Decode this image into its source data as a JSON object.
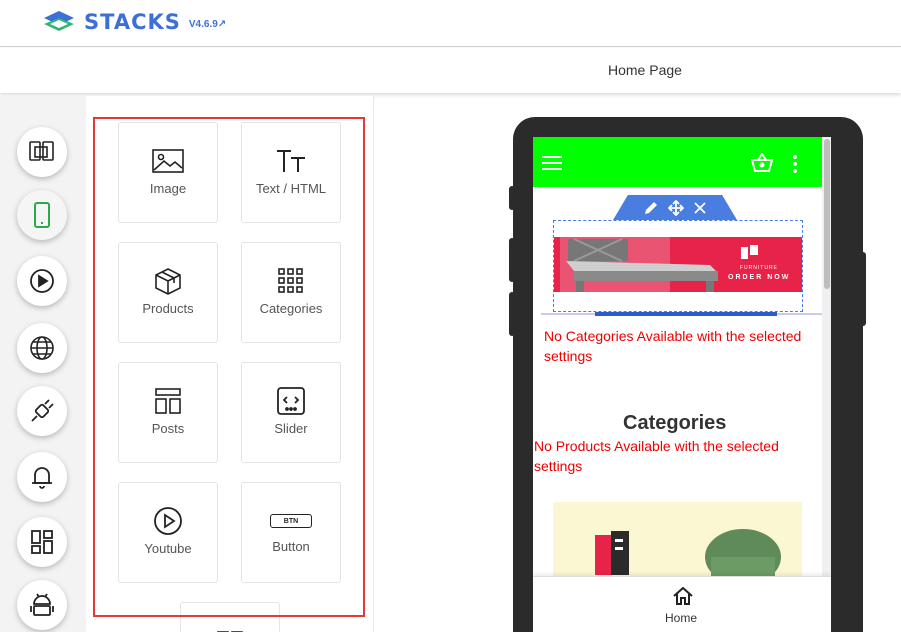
{
  "header": {
    "logo_text": "STACKS",
    "version": "V4.6.9",
    "page_title": "Home Page"
  },
  "rail": [
    {
      "icon": "devices-icon"
    },
    {
      "icon": "mobile-icon",
      "active": true
    },
    {
      "icon": "play-circle-icon"
    },
    {
      "icon": "globe-icon"
    },
    {
      "icon": "plug-icon"
    },
    {
      "icon": "bell-icon"
    },
    {
      "icon": "layout-icon"
    },
    {
      "icon": "android-icon"
    }
  ],
  "widgets": [
    {
      "label": "Image",
      "icon": "image-icon"
    },
    {
      "label": "Text / HTML",
      "icon": "text-icon"
    },
    {
      "label": "Products",
      "icon": "box-icon"
    },
    {
      "label": "Categories",
      "icon": "grid-icon"
    },
    {
      "label": "Posts",
      "icon": "posts-icon"
    },
    {
      "label": "Slider",
      "icon": "slider-icon"
    },
    {
      "label": "Youtube",
      "icon": "youtube-icon"
    },
    {
      "label": "Button",
      "icon": "button-icon",
      "badge": "BTN"
    }
  ],
  "preview": {
    "appbar_color": "#00ff00",
    "banner": {
      "brand": "FURNITURE",
      "cta": "ORDER NOW"
    },
    "no_categories": "No Categories Available with the selected settings",
    "categories_heading": "Categories",
    "no_products": "No Products Available with the selected settings",
    "bottom_nav_home": "Home"
  }
}
